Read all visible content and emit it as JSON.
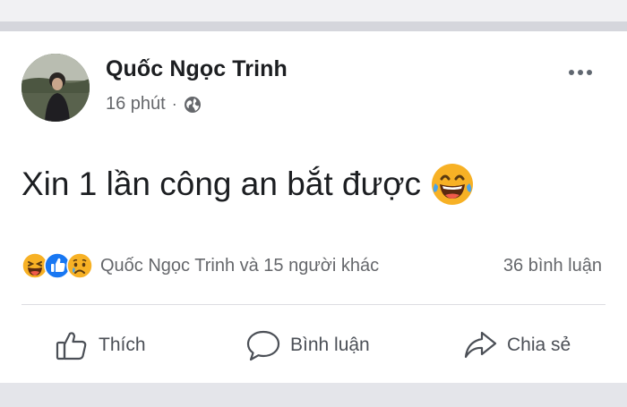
{
  "post": {
    "author": "Quốc Ngọc Trinh",
    "time": "16 phút",
    "separator": "·",
    "privacy_icon": "globe-icon",
    "text": "Xin 1 lần công an bắt được",
    "text_emoji": "laughing-tears-emoji"
  },
  "reactions": {
    "icons": [
      "haha-reaction-icon",
      "like-reaction-icon",
      "sad-reaction-icon"
    ],
    "names": "Quốc Ngọc Trinh và 15 người khác",
    "comments": "36 bình luận"
  },
  "actions": {
    "like": "Thích",
    "comment": "Bình luận",
    "share": "Chia sẻ"
  },
  "colors": {
    "like_blue": "#1877f2",
    "emoji_yellow": "#f7b125",
    "text_dark": "#1c1e21",
    "text_gray": "#65676b"
  }
}
